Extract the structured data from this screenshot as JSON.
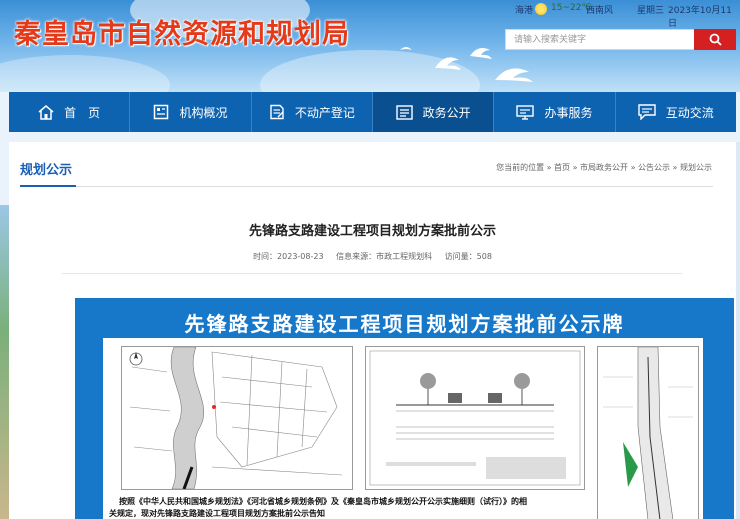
{
  "header": {
    "site_title": "秦皇岛市自然资源和规划局",
    "city": "海港",
    "temperature": "15~22℃",
    "wind": "西南风",
    "weekday": "星期三",
    "date": "2023年10月11日",
    "search_placeholder": "请输入搜索关键字"
  },
  "nav": {
    "items": [
      {
        "label": "首　页",
        "icon": "home-icon"
      },
      {
        "label": "机构概况",
        "icon": "org-icon"
      },
      {
        "label": "不动产登记",
        "icon": "register-icon"
      },
      {
        "label": "政务公开",
        "icon": "document-icon"
      },
      {
        "label": "办事服务",
        "icon": "service-icon"
      },
      {
        "label": "互动交流",
        "icon": "chat-icon"
      }
    ],
    "active_index": 3
  },
  "section": {
    "title": "规划公示",
    "breadcrumb": "您当前的位置 » 首页 » 市局政务公开 » 公告公示 » 规划公示"
  },
  "article": {
    "title": "先锋路支路建设工程项目规划方案批前公示",
    "date": "时间：2023-08-23",
    "source": "信息来源：市政工程规划科",
    "views": "访问量：508"
  },
  "poster": {
    "title": "先锋路支路建设工程项目规划方案批前公示牌",
    "text_line1": "按照《中华人民共和国城乡规划法》《河北省城乡规划条例》及《秦皇岛市城乡规划公开公示实施细则（试行）》的相",
    "text_line2": "关规定，现对先锋路支路建设工程项目规划方案批前公示告知"
  },
  "colors": {
    "nav_bg": "#0e63b0",
    "accent_red": "#d42020",
    "title_red": "#e53a1a",
    "section_blue": "#1a5fb4",
    "poster_blue": "#1778c9"
  }
}
